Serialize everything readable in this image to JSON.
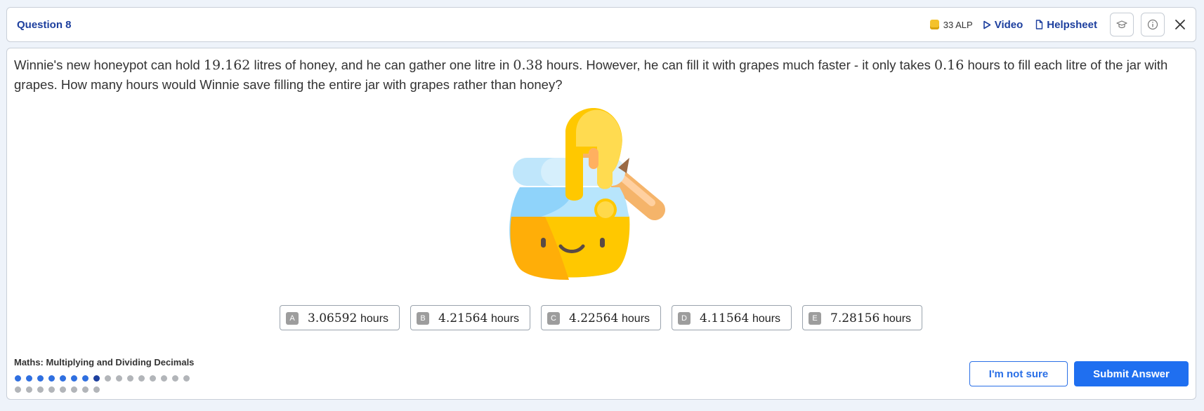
{
  "header": {
    "title": "Question 8",
    "alp": "33 ALP",
    "video_label": "Video",
    "helpsheet_label": "Helpsheet"
  },
  "question": {
    "t1": "Winnie's new honeypot can hold ",
    "n1": "19.162",
    "t2": " litres of honey, and he can gather one litre in ",
    "n2": "0.38",
    "t3": " hours. However, he can fill it with grapes much faster - it only takes ",
    "n3": "0.16",
    "t4": " hours to fill each litre of the jar with grapes. How many hours would Winnie save filling the entire jar with grapes rather than honey?"
  },
  "answers": [
    {
      "letter": "A",
      "value": "3.06592",
      "unit": "hours"
    },
    {
      "letter": "B",
      "value": "4.21564",
      "unit": "hours"
    },
    {
      "letter": "C",
      "value": "4.22564",
      "unit": "hours"
    },
    {
      "letter": "D",
      "value": "4.11564",
      "unit": "hours"
    },
    {
      "letter": "E",
      "value": "7.28156",
      "unit": "hours"
    }
  ],
  "footer": {
    "topic": "Maths: Multiplying and Dividing Decimals",
    "progress": {
      "total": 24,
      "completed": 7,
      "current": 8
    },
    "unsure_label": "I'm not sure",
    "submit_label": "Submit Answer"
  },
  "colors": {
    "accent": "#1f6ff0",
    "title": "#1d3f9e",
    "dot_done": "#2f6fe0",
    "dot_pending": "#b2b5b9"
  },
  "icons": [
    "coin-icon",
    "play-icon",
    "document-icon",
    "graduation-cap-icon",
    "info-icon",
    "close-icon"
  ]
}
